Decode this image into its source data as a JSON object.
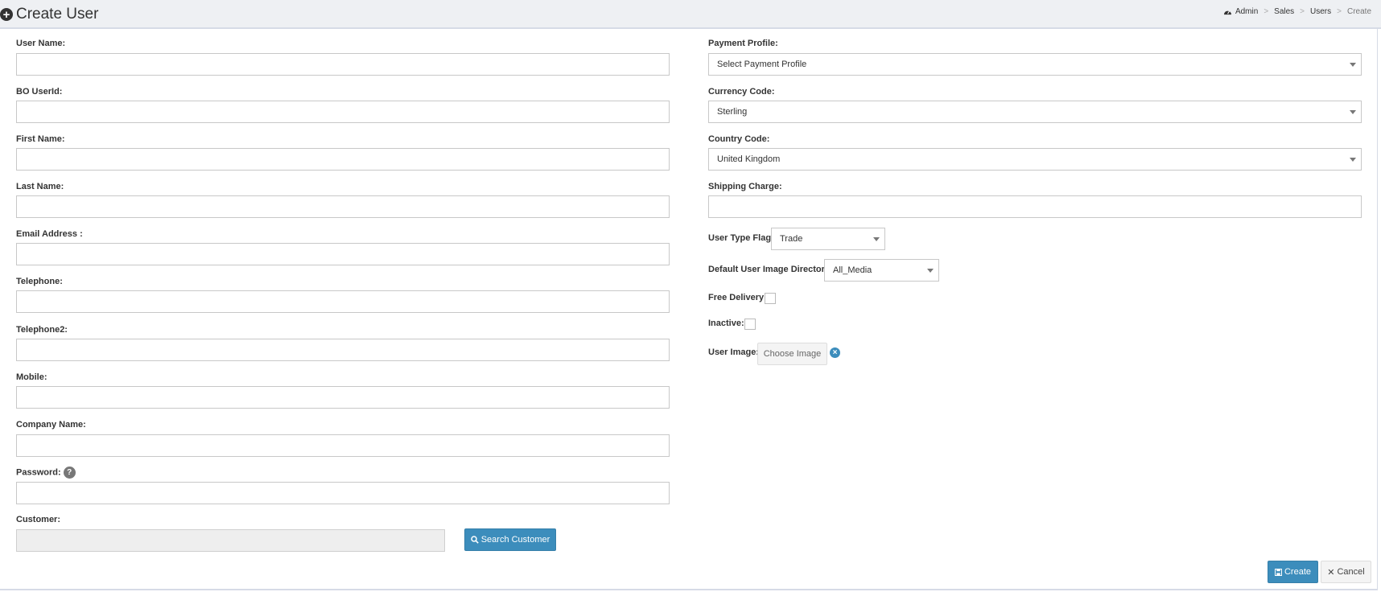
{
  "header": {
    "title": "Create User",
    "breadcrumb": [
      "Admin",
      "Sales",
      "Users",
      "Create"
    ]
  },
  "left_fields": [
    {
      "label": "User Name:",
      "value": ""
    },
    {
      "label": "BO UserId:",
      "value": ""
    },
    {
      "label": "First Name:",
      "value": ""
    },
    {
      "label": "Last Name:",
      "value": ""
    },
    {
      "label": "Email Address :",
      "value": ""
    },
    {
      "label": "Telephone:",
      "value": ""
    },
    {
      "label": "Telephone2:",
      "value": ""
    },
    {
      "label": "Mobile:",
      "value": ""
    },
    {
      "label": "Company Name:",
      "value": ""
    },
    {
      "label": "Password:",
      "value": "",
      "help_icon": "question-icon"
    }
  ],
  "customer": {
    "label": "Customer:",
    "value": "",
    "search_button": "Search Customer"
  },
  "right_fields": {
    "payment_profile": {
      "label": "Payment Profile:",
      "selected": "Select Payment Profile"
    },
    "currency_code": {
      "label": "Currency Code:",
      "selected": "Sterling"
    },
    "country_code": {
      "label": "Country Code:",
      "selected": "United Kingdom"
    },
    "shipping_charge": {
      "label": "Shipping Charge:",
      "value": ""
    },
    "user_type_flag": {
      "label": "User Type Flag:",
      "selected": "Trade"
    },
    "default_image_dir": {
      "label": "Default User Image Directory",
      "selected": "All_Media"
    },
    "free_delivery": {
      "label": "Free Delivery:",
      "checked": false
    },
    "inactive": {
      "label": "Inactive:",
      "checked": false
    },
    "user_image": {
      "label": "User Image:",
      "button": "Choose Image"
    }
  },
  "footer": {
    "create_button": "Create",
    "cancel_button": "Cancel"
  },
  "colors": {
    "primary": "#3c8dbc",
    "header_bg": "#eef0f3"
  }
}
